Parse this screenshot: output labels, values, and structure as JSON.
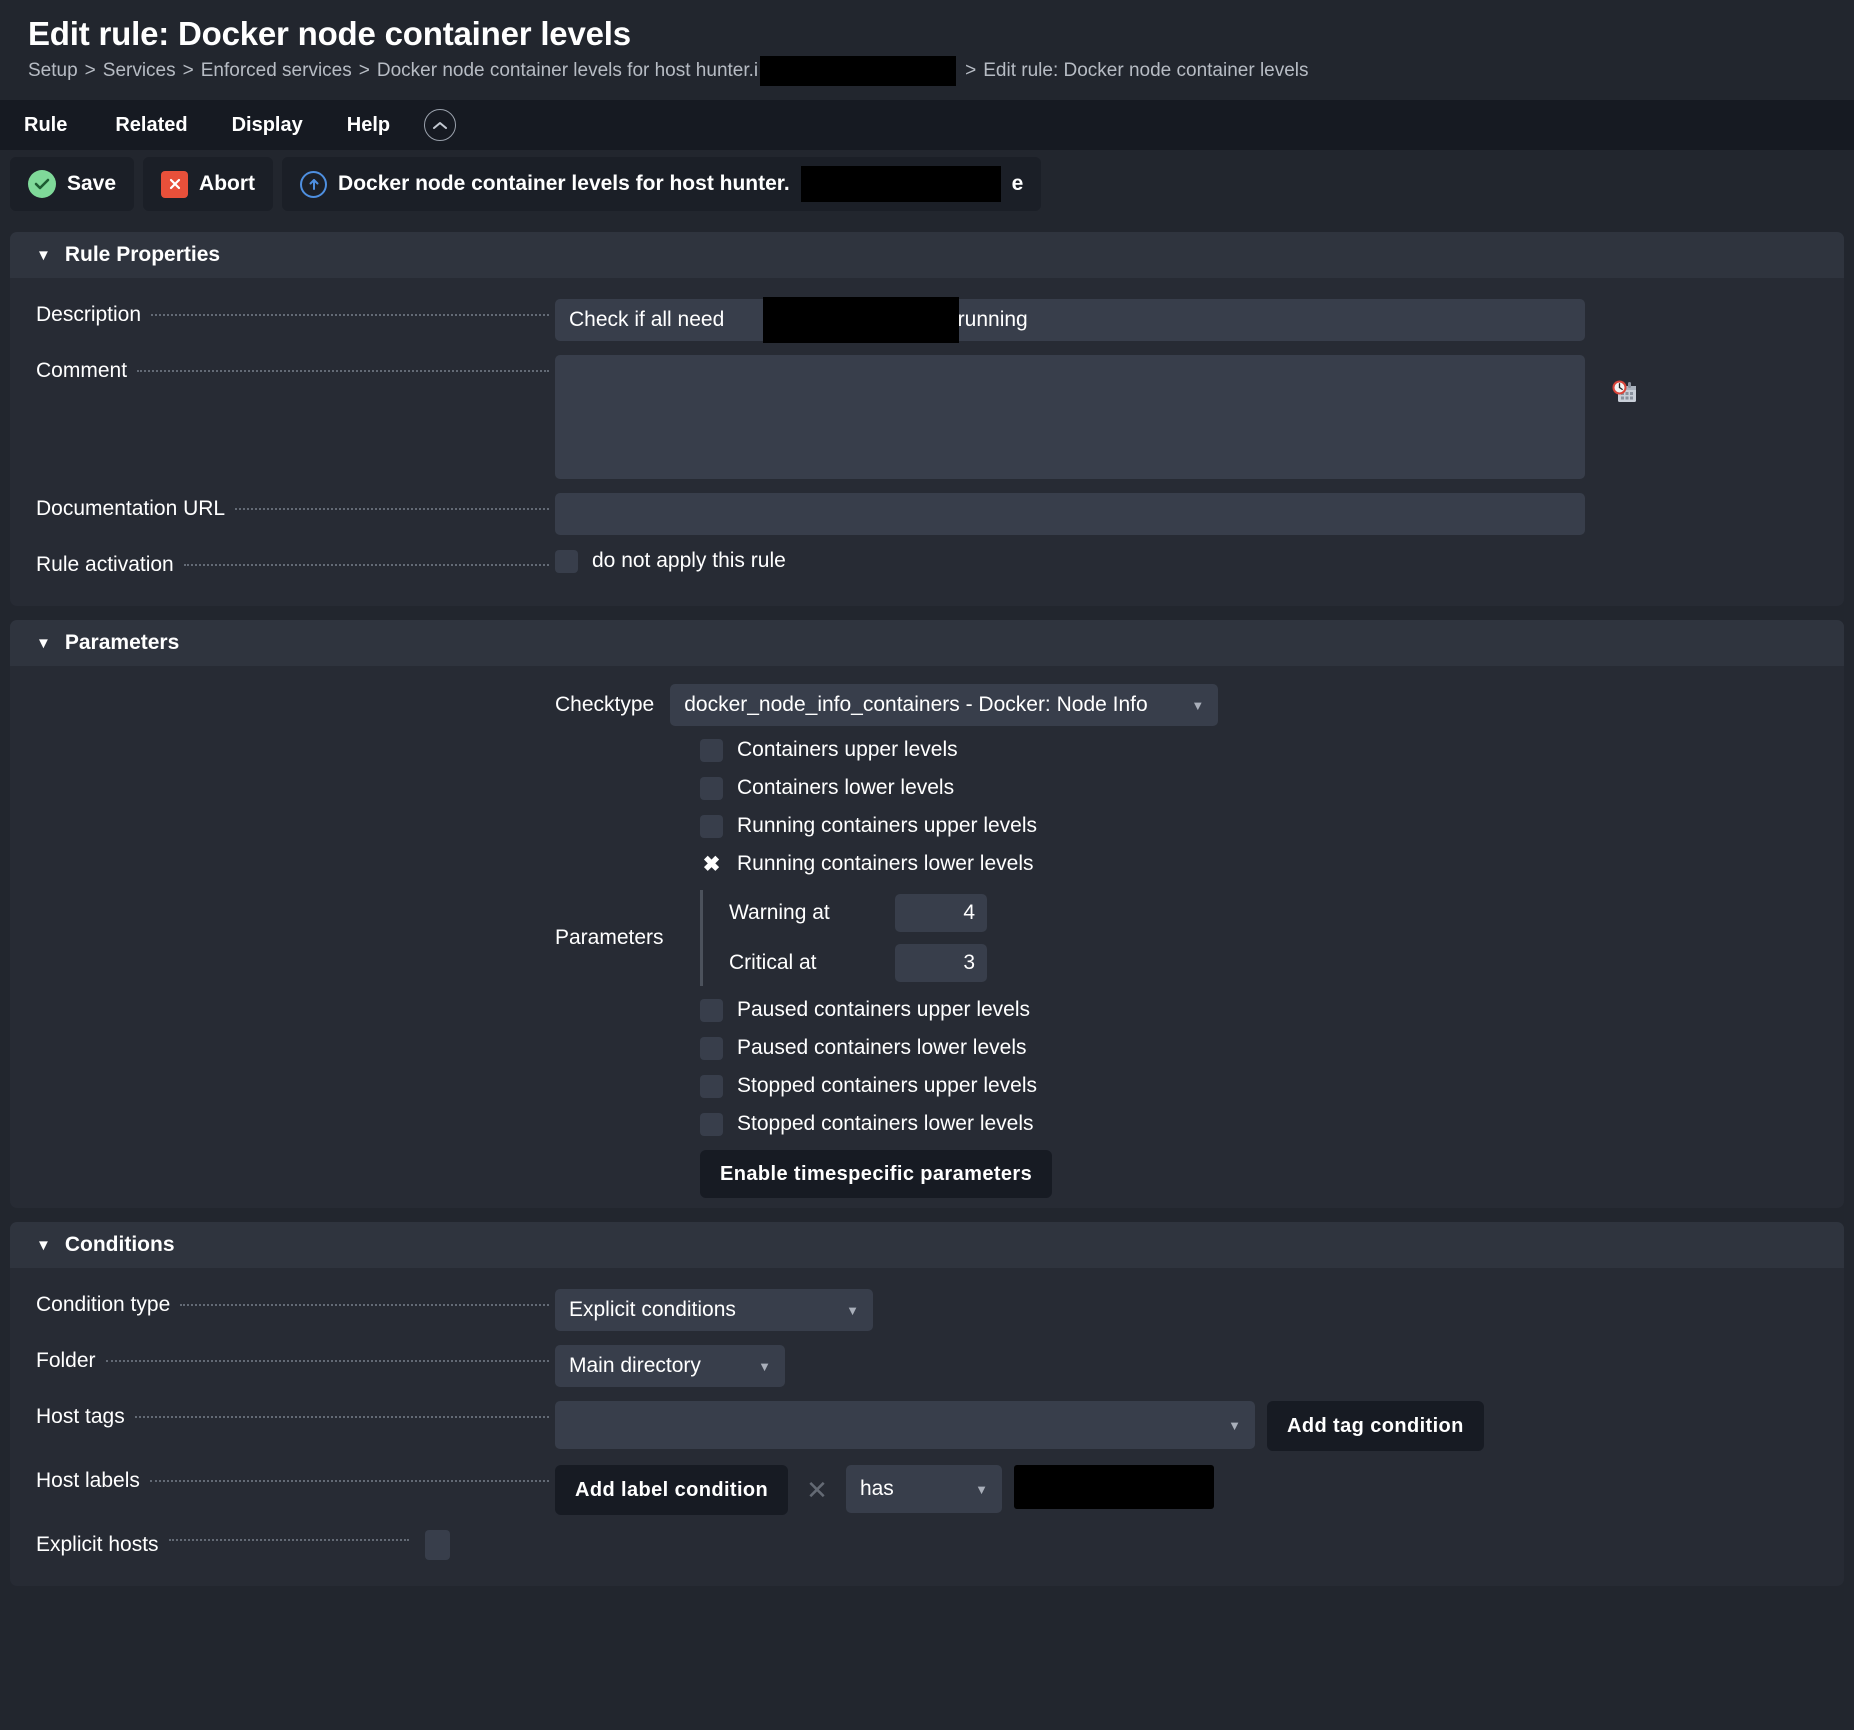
{
  "header": {
    "title": "Edit rule: Docker node container levels",
    "breadcrumb": [
      "Setup",
      "Services",
      "Enforced services",
      "Docker node container levels for host hunter.i",
      "Edit rule: Docker node container levels"
    ],
    "breadcrumb_separator": ">"
  },
  "menubar": {
    "items": [
      "Rule",
      "Related",
      "Display",
      "Help"
    ],
    "collapse_icon": "chevron-up-circle-icon"
  },
  "toolbar": {
    "save_label": "Save",
    "abort_label": "Abort",
    "context_label_prefix": "Docker node container levels for host hunter.",
    "context_label_suffix": "e",
    "save_icon": "check-circle-icon",
    "abort_icon": "close-square-icon",
    "context_icon": "arrow-up-circle-icon"
  },
  "rule_properties": {
    "section_title": "Rule Properties",
    "description_label": "Description",
    "description_value_before": "Check if all need",
    "description_value_after": "ntainers are running",
    "comment_label": "Comment",
    "comment_value": "",
    "comment_icon": "clock-calendar-icon",
    "doc_url_label": "Documentation URL",
    "doc_url_value": "",
    "rule_activation_label": "Rule activation",
    "rule_activation_checkbox_label": "do not apply this rule",
    "rule_activation_checked": false
  },
  "parameters": {
    "section_title": "Parameters",
    "checktype_label": "Checktype",
    "checktype_value": "docker_node_info_containers - Docker: Node Info",
    "options_top": [
      {
        "label": "Containers upper levels",
        "checked": false
      },
      {
        "label": "Containers lower levels",
        "checked": false
      },
      {
        "label": "Running containers upper levels",
        "checked": false
      },
      {
        "label": "Running containers lower levels",
        "checked": true
      }
    ],
    "levels_label": "Parameters",
    "levels": [
      {
        "label": "Warning at",
        "value": "4"
      },
      {
        "label": "Critical at",
        "value": "3"
      }
    ],
    "options_bottom": [
      {
        "label": "Paused containers upper levels",
        "checked": false
      },
      {
        "label": "Paused containers lower levels",
        "checked": false
      },
      {
        "label": "Stopped containers upper levels",
        "checked": false
      },
      {
        "label": "Stopped containers lower levels",
        "checked": false
      }
    ],
    "timespecific_button": "Enable timespecific parameters"
  },
  "conditions": {
    "section_title": "Conditions",
    "condition_type_label": "Condition type",
    "condition_type_value": "Explicit conditions",
    "folder_label": "Folder",
    "folder_value": "Main directory",
    "host_tags_label": "Host tags",
    "host_tags_value": "",
    "add_tag_condition_button": "Add tag condition",
    "host_labels_label": "Host labels",
    "add_label_condition_button": "Add label condition",
    "host_label_operator": "has",
    "explicit_hosts_label": "Explicit hosts",
    "explicit_hosts_checked": false
  },
  "colors": {
    "page_bg": "#22262e",
    "menubar_bg": "#161a22",
    "card_bg": "#272b34",
    "card_header_bg": "#2f343e",
    "input_bg": "#383e4b",
    "dark_button_bg": "#171b23",
    "accent_save": "#7fd999",
    "accent_abort": "#e8503a",
    "accent_link": "#4e8fe0",
    "redaction": "#000000"
  }
}
